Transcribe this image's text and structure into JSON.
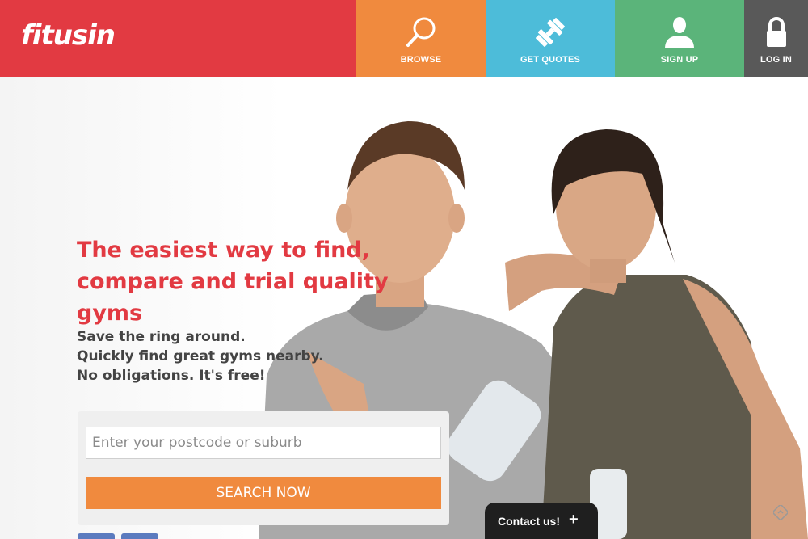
{
  "brand": {
    "logo_text": "fitusin",
    "color": "#e23a42"
  },
  "nav": [
    {
      "label": "BROWSE",
      "icon": "search-icon",
      "color": "#f08a3e"
    },
    {
      "label": "GET QUOTES",
      "icon": "dumbbell-icon",
      "color": "#4dbcd9"
    },
    {
      "label": "SIGN UP",
      "icon": "user-icon",
      "color": "#5bb47a"
    },
    {
      "label": "LOG IN",
      "icon": "lock-icon",
      "color": "#595959"
    }
  ],
  "hero": {
    "headline_line1": "The easiest way to find,",
    "headline_line2": "compare and trial quality gyms",
    "sub_line1": "Save the ring around.",
    "sub_line2": "Quickly find great gyms nearby.",
    "sub_line3": "No obligations. It's free!"
  },
  "search": {
    "placeholder": "Enter your postcode or suburb",
    "value": "",
    "button_label": "SEARCH NOW"
  },
  "contact": {
    "label": "Contact us!",
    "plus": "+"
  }
}
